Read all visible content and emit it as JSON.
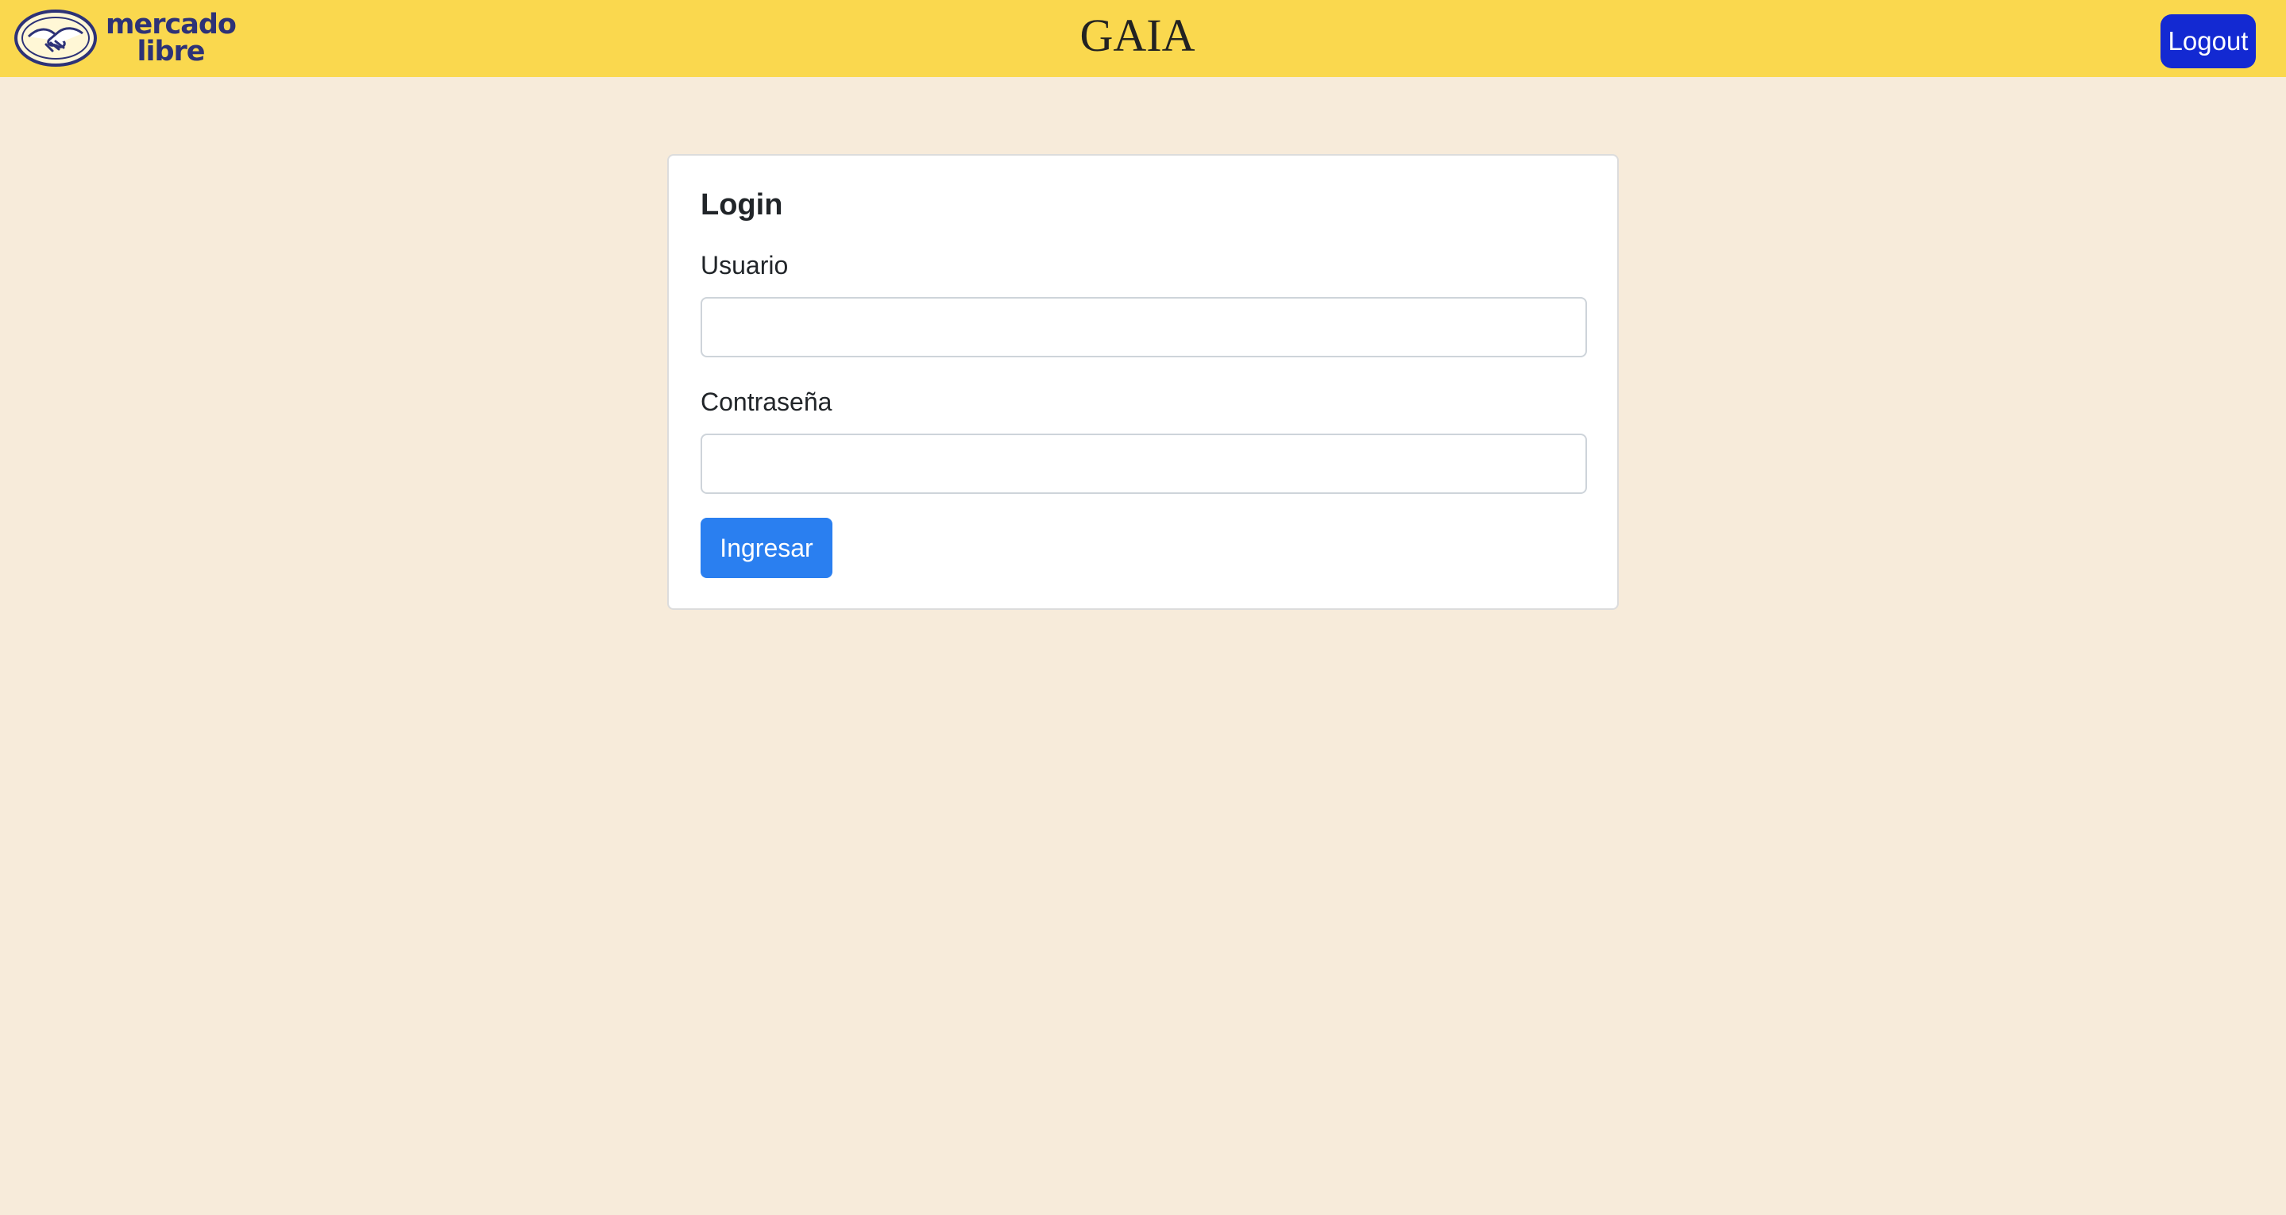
{
  "header": {
    "logo_alt": "mercado libre",
    "logo_line1": "mercado",
    "logo_line2": "libre",
    "app_title": "GAIA",
    "logout_label": "Logout"
  },
  "login": {
    "title": "Login",
    "username_label": "Usuario",
    "username_value": "",
    "password_label": "Contraseña",
    "password_value": "",
    "submit_label": "Ingresar"
  },
  "colors": {
    "header_bg": "#fad84e",
    "page_bg": "#f7ebda",
    "logout_button": "#1329d2",
    "submit_button": "#2a7ff0",
    "logo_text": "#2d3277"
  },
  "icons": {
    "logo": "handshake-icon"
  }
}
